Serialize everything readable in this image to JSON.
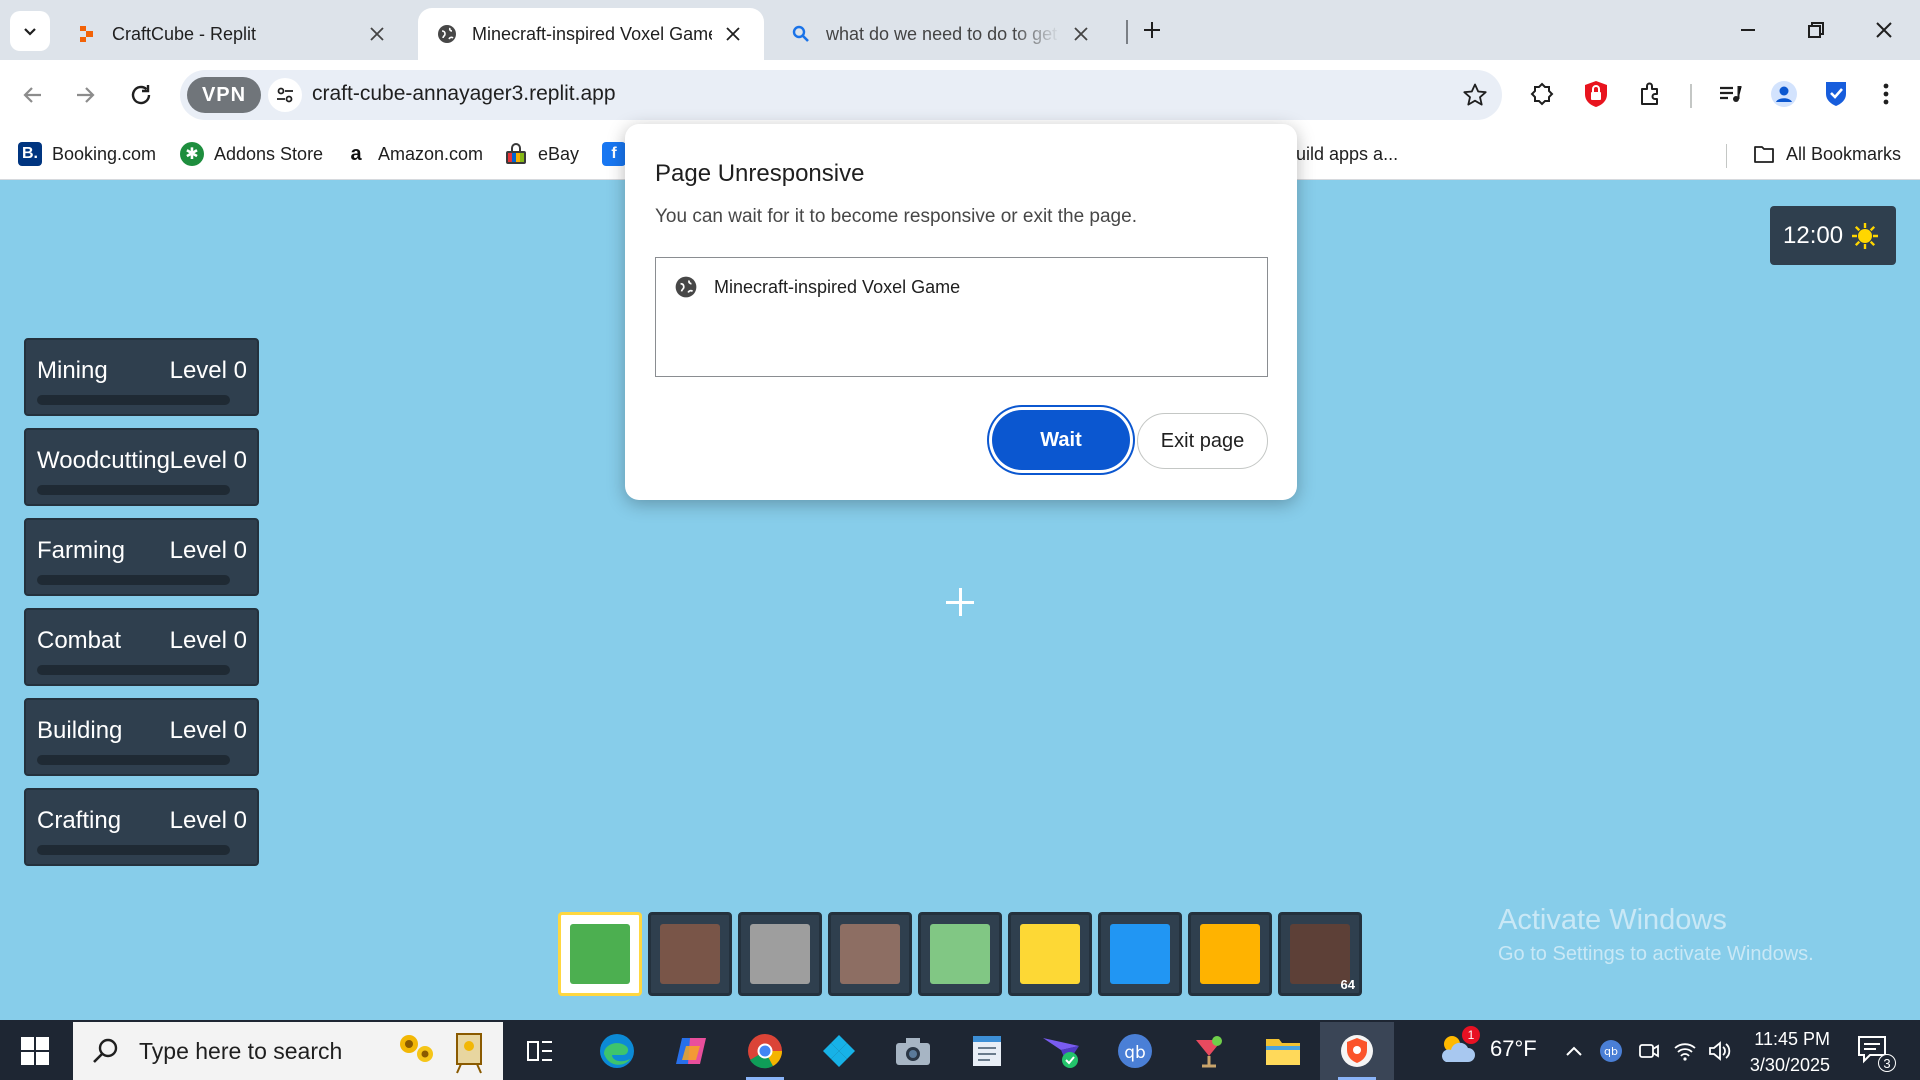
{
  "browser": {
    "tabs": [
      {
        "title": "CraftCube - Replit",
        "active": false
      },
      {
        "title": "Minecraft-inspired Voxel Game",
        "active": true
      },
      {
        "title": "what do we need to do to get th",
        "active": false
      }
    ],
    "url": "craft-cube-annayager3.replit.app",
    "vpn_label": "VPN",
    "bookmarks": [
      {
        "label": "Booking.com",
        "icon": "booking-icon"
      },
      {
        "label": "Addons Store",
        "icon": "addons-store-icon"
      },
      {
        "label": "Amazon.com",
        "icon": "amazon-icon"
      },
      {
        "label": "eBay",
        "icon": "ebay-icon"
      },
      {
        "label": "uild apps a...",
        "icon": "replit-icon"
      }
    ],
    "all_bookmarks_label": "All Bookmarks"
  },
  "dialog": {
    "title": "Page Unresponsive",
    "description": "You can wait for it to become responsive or exit the page.",
    "item": "Minecraft-inspired Voxel Game",
    "wait_label": "Wait",
    "exit_label": "Exit page"
  },
  "game": {
    "clock": "12:00",
    "skills": [
      {
        "name": "Mining",
        "level": "Level 0",
        "progress": 0
      },
      {
        "name": "Woodcutting",
        "level": "Level 0",
        "progress": 0
      },
      {
        "name": "Farming",
        "level": "Level 0",
        "progress": 0
      },
      {
        "name": "Combat",
        "level": "Level 0",
        "progress": 0
      },
      {
        "name": "Building",
        "level": "Level 0",
        "progress": 0
      },
      {
        "name": "Crafting",
        "level": "Level 0",
        "progress": 0
      }
    ],
    "hotbar": [
      {
        "color": "#4caf50",
        "selected": true
      },
      {
        "color": "#795548",
        "selected": false
      },
      {
        "color": "#9e9e9e",
        "selected": false
      },
      {
        "color": "#8d6e63",
        "selected": false
      },
      {
        "color": "#81c784",
        "selected": false
      },
      {
        "color": "#fdd835",
        "selected": false
      },
      {
        "color": "#2196f3",
        "selected": false
      },
      {
        "color": "#ffb300",
        "selected": false
      },
      {
        "color": "#5d4037",
        "selected": false,
        "count": "64"
      }
    ]
  },
  "watermark": {
    "line1": "Activate Windows",
    "line2": "Go to Settings to activate Windows."
  },
  "taskbar": {
    "search_placeholder": "Type here to search",
    "weather_temp": "67°F",
    "weather_badge": "1",
    "time": "11:45 PM",
    "date": "3/30/2025",
    "notification_count": "3"
  },
  "colors": {
    "game_sky": "#87cdea",
    "panel": "#2f3f4e",
    "accent": "#0b57d0"
  }
}
